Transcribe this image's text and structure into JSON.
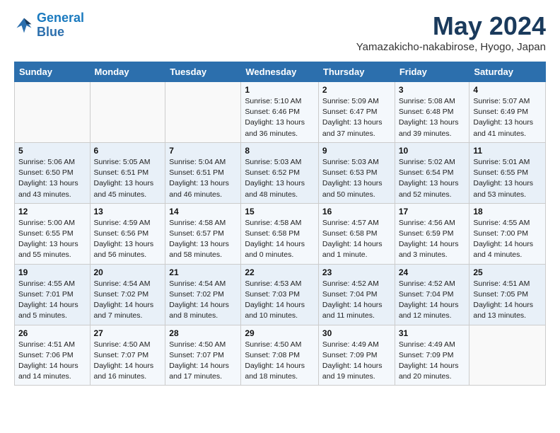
{
  "logo": {
    "line1": "General",
    "line2": "Blue"
  },
  "title": "May 2024",
  "location": "Yamazakicho-nakabirose, Hyogo, Japan",
  "weekdays": [
    "Sunday",
    "Monday",
    "Tuesday",
    "Wednesday",
    "Thursday",
    "Friday",
    "Saturday"
  ],
  "weeks": [
    [
      {
        "day": "",
        "info": ""
      },
      {
        "day": "",
        "info": ""
      },
      {
        "day": "",
        "info": ""
      },
      {
        "day": "1",
        "info": "Sunrise: 5:10 AM\nSunset: 6:46 PM\nDaylight: 13 hours and 36 minutes."
      },
      {
        "day": "2",
        "info": "Sunrise: 5:09 AM\nSunset: 6:47 PM\nDaylight: 13 hours and 37 minutes."
      },
      {
        "day": "3",
        "info": "Sunrise: 5:08 AM\nSunset: 6:48 PM\nDaylight: 13 hours and 39 minutes."
      },
      {
        "day": "4",
        "info": "Sunrise: 5:07 AM\nSunset: 6:49 PM\nDaylight: 13 hours and 41 minutes."
      }
    ],
    [
      {
        "day": "5",
        "info": "Sunrise: 5:06 AM\nSunset: 6:50 PM\nDaylight: 13 hours and 43 minutes."
      },
      {
        "day": "6",
        "info": "Sunrise: 5:05 AM\nSunset: 6:51 PM\nDaylight: 13 hours and 45 minutes."
      },
      {
        "day": "7",
        "info": "Sunrise: 5:04 AM\nSunset: 6:51 PM\nDaylight: 13 hours and 46 minutes."
      },
      {
        "day": "8",
        "info": "Sunrise: 5:03 AM\nSunset: 6:52 PM\nDaylight: 13 hours and 48 minutes."
      },
      {
        "day": "9",
        "info": "Sunrise: 5:03 AM\nSunset: 6:53 PM\nDaylight: 13 hours and 50 minutes."
      },
      {
        "day": "10",
        "info": "Sunrise: 5:02 AM\nSunset: 6:54 PM\nDaylight: 13 hours and 52 minutes."
      },
      {
        "day": "11",
        "info": "Sunrise: 5:01 AM\nSunset: 6:55 PM\nDaylight: 13 hours and 53 minutes."
      }
    ],
    [
      {
        "day": "12",
        "info": "Sunrise: 5:00 AM\nSunset: 6:55 PM\nDaylight: 13 hours and 55 minutes."
      },
      {
        "day": "13",
        "info": "Sunrise: 4:59 AM\nSunset: 6:56 PM\nDaylight: 13 hours and 56 minutes."
      },
      {
        "day": "14",
        "info": "Sunrise: 4:58 AM\nSunset: 6:57 PM\nDaylight: 13 hours and 58 minutes."
      },
      {
        "day": "15",
        "info": "Sunrise: 4:58 AM\nSunset: 6:58 PM\nDaylight: 14 hours and 0 minutes."
      },
      {
        "day": "16",
        "info": "Sunrise: 4:57 AM\nSunset: 6:58 PM\nDaylight: 14 hours and 1 minute."
      },
      {
        "day": "17",
        "info": "Sunrise: 4:56 AM\nSunset: 6:59 PM\nDaylight: 14 hours and 3 minutes."
      },
      {
        "day": "18",
        "info": "Sunrise: 4:55 AM\nSunset: 7:00 PM\nDaylight: 14 hours and 4 minutes."
      }
    ],
    [
      {
        "day": "19",
        "info": "Sunrise: 4:55 AM\nSunset: 7:01 PM\nDaylight: 14 hours and 5 minutes."
      },
      {
        "day": "20",
        "info": "Sunrise: 4:54 AM\nSunset: 7:02 PM\nDaylight: 14 hours and 7 minutes."
      },
      {
        "day": "21",
        "info": "Sunrise: 4:54 AM\nSunset: 7:02 PM\nDaylight: 14 hours and 8 minutes."
      },
      {
        "day": "22",
        "info": "Sunrise: 4:53 AM\nSunset: 7:03 PM\nDaylight: 14 hours and 10 minutes."
      },
      {
        "day": "23",
        "info": "Sunrise: 4:52 AM\nSunset: 7:04 PM\nDaylight: 14 hours and 11 minutes."
      },
      {
        "day": "24",
        "info": "Sunrise: 4:52 AM\nSunset: 7:04 PM\nDaylight: 14 hours and 12 minutes."
      },
      {
        "day": "25",
        "info": "Sunrise: 4:51 AM\nSunset: 7:05 PM\nDaylight: 14 hours and 13 minutes."
      }
    ],
    [
      {
        "day": "26",
        "info": "Sunrise: 4:51 AM\nSunset: 7:06 PM\nDaylight: 14 hours and 14 minutes."
      },
      {
        "day": "27",
        "info": "Sunrise: 4:50 AM\nSunset: 7:07 PM\nDaylight: 14 hours and 16 minutes."
      },
      {
        "day": "28",
        "info": "Sunrise: 4:50 AM\nSunset: 7:07 PM\nDaylight: 14 hours and 17 minutes."
      },
      {
        "day": "29",
        "info": "Sunrise: 4:50 AM\nSunset: 7:08 PM\nDaylight: 14 hours and 18 minutes."
      },
      {
        "day": "30",
        "info": "Sunrise: 4:49 AM\nSunset: 7:09 PM\nDaylight: 14 hours and 19 minutes."
      },
      {
        "day": "31",
        "info": "Sunrise: 4:49 AM\nSunset: 7:09 PM\nDaylight: 14 hours and 20 minutes."
      },
      {
        "day": "",
        "info": ""
      }
    ]
  ]
}
